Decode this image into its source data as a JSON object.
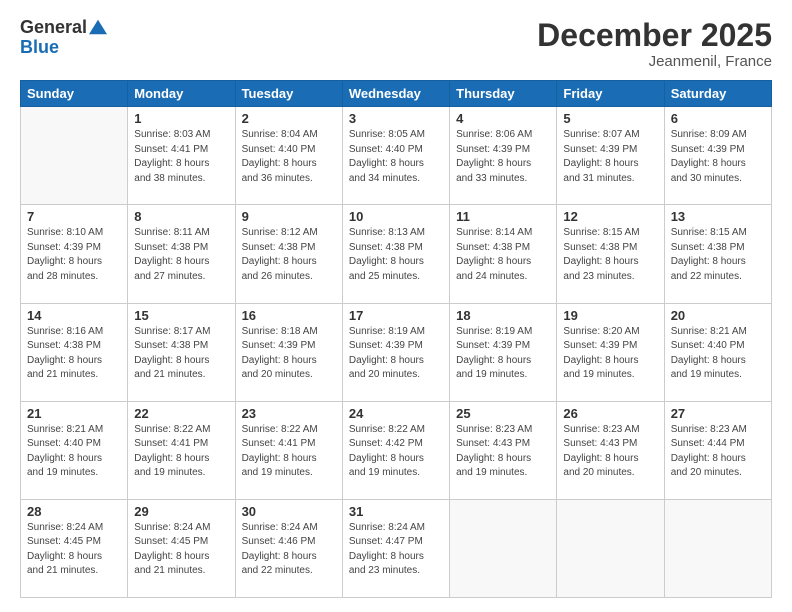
{
  "header": {
    "logo_line1": "General",
    "logo_line2": "Blue",
    "month_title": "December 2025",
    "location": "Jeanmenil, France"
  },
  "weekdays": [
    "Sunday",
    "Monday",
    "Tuesday",
    "Wednesday",
    "Thursday",
    "Friday",
    "Saturday"
  ],
  "weeks": [
    [
      {
        "day": "",
        "info": ""
      },
      {
        "day": "1",
        "info": "Sunrise: 8:03 AM\nSunset: 4:41 PM\nDaylight: 8 hours\nand 38 minutes."
      },
      {
        "day": "2",
        "info": "Sunrise: 8:04 AM\nSunset: 4:40 PM\nDaylight: 8 hours\nand 36 minutes."
      },
      {
        "day": "3",
        "info": "Sunrise: 8:05 AM\nSunset: 4:40 PM\nDaylight: 8 hours\nand 34 minutes."
      },
      {
        "day": "4",
        "info": "Sunrise: 8:06 AM\nSunset: 4:39 PM\nDaylight: 8 hours\nand 33 minutes."
      },
      {
        "day": "5",
        "info": "Sunrise: 8:07 AM\nSunset: 4:39 PM\nDaylight: 8 hours\nand 31 minutes."
      },
      {
        "day": "6",
        "info": "Sunrise: 8:09 AM\nSunset: 4:39 PM\nDaylight: 8 hours\nand 30 minutes."
      }
    ],
    [
      {
        "day": "7",
        "info": "Sunrise: 8:10 AM\nSunset: 4:39 PM\nDaylight: 8 hours\nand 28 minutes."
      },
      {
        "day": "8",
        "info": "Sunrise: 8:11 AM\nSunset: 4:38 PM\nDaylight: 8 hours\nand 27 minutes."
      },
      {
        "day": "9",
        "info": "Sunrise: 8:12 AM\nSunset: 4:38 PM\nDaylight: 8 hours\nand 26 minutes."
      },
      {
        "day": "10",
        "info": "Sunrise: 8:13 AM\nSunset: 4:38 PM\nDaylight: 8 hours\nand 25 minutes."
      },
      {
        "day": "11",
        "info": "Sunrise: 8:14 AM\nSunset: 4:38 PM\nDaylight: 8 hours\nand 24 minutes."
      },
      {
        "day": "12",
        "info": "Sunrise: 8:15 AM\nSunset: 4:38 PM\nDaylight: 8 hours\nand 23 minutes."
      },
      {
        "day": "13",
        "info": "Sunrise: 8:15 AM\nSunset: 4:38 PM\nDaylight: 8 hours\nand 22 minutes."
      }
    ],
    [
      {
        "day": "14",
        "info": "Sunrise: 8:16 AM\nSunset: 4:38 PM\nDaylight: 8 hours\nand 21 minutes."
      },
      {
        "day": "15",
        "info": "Sunrise: 8:17 AM\nSunset: 4:38 PM\nDaylight: 8 hours\nand 21 minutes."
      },
      {
        "day": "16",
        "info": "Sunrise: 8:18 AM\nSunset: 4:39 PM\nDaylight: 8 hours\nand 20 minutes."
      },
      {
        "day": "17",
        "info": "Sunrise: 8:19 AM\nSunset: 4:39 PM\nDaylight: 8 hours\nand 20 minutes."
      },
      {
        "day": "18",
        "info": "Sunrise: 8:19 AM\nSunset: 4:39 PM\nDaylight: 8 hours\nand 19 minutes."
      },
      {
        "day": "19",
        "info": "Sunrise: 8:20 AM\nSunset: 4:39 PM\nDaylight: 8 hours\nand 19 minutes."
      },
      {
        "day": "20",
        "info": "Sunrise: 8:21 AM\nSunset: 4:40 PM\nDaylight: 8 hours\nand 19 minutes."
      }
    ],
    [
      {
        "day": "21",
        "info": "Sunrise: 8:21 AM\nSunset: 4:40 PM\nDaylight: 8 hours\nand 19 minutes."
      },
      {
        "day": "22",
        "info": "Sunrise: 8:22 AM\nSunset: 4:41 PM\nDaylight: 8 hours\nand 19 minutes."
      },
      {
        "day": "23",
        "info": "Sunrise: 8:22 AM\nSunset: 4:41 PM\nDaylight: 8 hours\nand 19 minutes."
      },
      {
        "day": "24",
        "info": "Sunrise: 8:22 AM\nSunset: 4:42 PM\nDaylight: 8 hours\nand 19 minutes."
      },
      {
        "day": "25",
        "info": "Sunrise: 8:23 AM\nSunset: 4:43 PM\nDaylight: 8 hours\nand 19 minutes."
      },
      {
        "day": "26",
        "info": "Sunrise: 8:23 AM\nSunset: 4:43 PM\nDaylight: 8 hours\nand 20 minutes."
      },
      {
        "day": "27",
        "info": "Sunrise: 8:23 AM\nSunset: 4:44 PM\nDaylight: 8 hours\nand 20 minutes."
      }
    ],
    [
      {
        "day": "28",
        "info": "Sunrise: 8:24 AM\nSunset: 4:45 PM\nDaylight: 8 hours\nand 21 minutes."
      },
      {
        "day": "29",
        "info": "Sunrise: 8:24 AM\nSunset: 4:45 PM\nDaylight: 8 hours\nand 21 minutes."
      },
      {
        "day": "30",
        "info": "Sunrise: 8:24 AM\nSunset: 4:46 PM\nDaylight: 8 hours\nand 22 minutes."
      },
      {
        "day": "31",
        "info": "Sunrise: 8:24 AM\nSunset: 4:47 PM\nDaylight: 8 hours\nand 23 minutes."
      },
      {
        "day": "",
        "info": ""
      },
      {
        "day": "",
        "info": ""
      },
      {
        "day": "",
        "info": ""
      }
    ]
  ]
}
